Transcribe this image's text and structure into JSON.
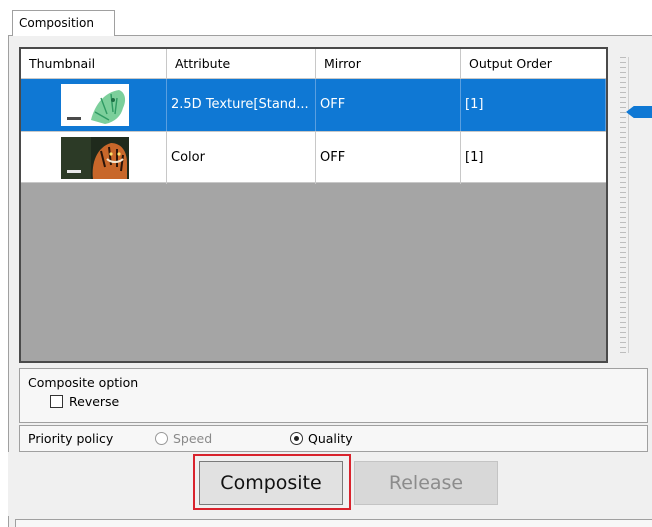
{
  "tab": {
    "label": "Composition"
  },
  "table": {
    "columns": [
      "Thumbnail",
      "Attribute",
      "Mirror",
      "Output Order"
    ],
    "rows": [
      {
        "thumbnail": "tiger-sketch-thumbnail",
        "attribute": "2.5D Texture[Stand...",
        "mirror": "OFF",
        "output_order": "[1]",
        "selected": true
      },
      {
        "thumbnail": "tiger-photo-thumbnail",
        "attribute": "Color",
        "mirror": "OFF",
        "output_order": "[1]",
        "selected": false
      }
    ]
  },
  "composite_option": {
    "title": "Composite option",
    "reverse_label": "Reverse",
    "reverse_checked": false
  },
  "priority": {
    "label": "Priority policy",
    "speed_label": "Speed",
    "quality_label": "Quality",
    "selected": "Quality"
  },
  "buttons": {
    "composite": "Composite",
    "release": "Release"
  },
  "colors": {
    "selection": "#0f78d4",
    "highlight": "#d9232d",
    "grid_empty": "#a5a5a5"
  }
}
